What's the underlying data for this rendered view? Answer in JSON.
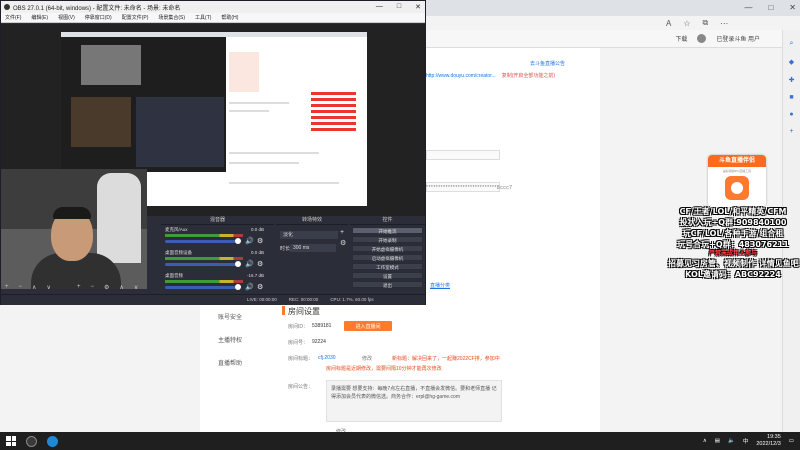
{
  "obs": {
    "title": "OBS 27.0.1 (64-bit, windows) - 配置文件: 未命名 - 场景: 未命名",
    "menu": [
      "文件(F)",
      "编辑(E)",
      "视图(V)",
      "停靠窗口(D)",
      "配置文件(P)",
      "场景集合(S)",
      "工具(T)",
      "帮助(H)"
    ],
    "docks": {
      "mixer_title": "混音器",
      "transitions_title": "转场特效",
      "controls_title": "控件",
      "scenes_title": "场景"
    },
    "mixer": [
      {
        "name": "麦克风/Aux",
        "db": "0.0 dB"
      },
      {
        "name": "桌面音频设备",
        "db": "0.0 dB"
      },
      {
        "name": "桌面音频",
        "db": "-16.7 dB"
      }
    ],
    "transition": {
      "selected": "淡化",
      "duration_label": "时长",
      "duration": "300 ms"
    },
    "controls": [
      "开始推流",
      "开始录制",
      "开始虚拟摄像机",
      "启动虚拟摄像机",
      "工作室模式",
      "设置",
      "退出"
    ],
    "status": {
      "live": "LIVE: 00:00:00",
      "rec": "REC: 00:00:00",
      "cpu": "CPU: 1.7%, 60.00 fps"
    }
  },
  "edge": {
    "download_label": "下载",
    "account_label": "已登录斗鱼 用户"
  },
  "page": {
    "url": "http://www.douyu.com/creator...",
    "url_note": "复制(开启全部功能之前)",
    "top_note": "去斗鱼直播公告",
    "stream_key_mask": "*****************************8ccc7",
    "nav": [
      "账号安全",
      "主播特权",
      "直播帮助"
    ],
    "room_section_title": "房间设置",
    "room_id_label": "房间ID：",
    "room_id": "5389181",
    "room_id_btn": "进入直播间",
    "room_number_label": "房间号：",
    "room_number": "92224",
    "room_title_label": "房间标题：",
    "room_title_link": "cfj.2030",
    "room_title_edit": "修改",
    "room_title_red": "新标题：解决回来了，一起赚2022CF排，参加中",
    "room_title_red2": "房间标题是近期修改，需要间隔10分钟才能再次修改",
    "notice_label": "房间公告：",
    "notice_text": "录播需要 想要支持：每晚7点左右直播，不直播会发微信。要和老师直播 记得添加会员代表的微信选。商务合作：erpl@hg-game.com",
    "link": "直播分类",
    "sub_label": "修改"
  },
  "overlay": {
    "card_title": "斗鱼直播伴侣",
    "card_sub": "是好用的PC直播工具",
    "lines": [
      "CF/王者/LOL/和平精英/CFM",
      "投状入玩+Q群:909840100",
      "玩CF/LOL/各种手游/组合租",
      "玩号合玩+Q群：483076211",
      "严禁未成年人参与",
      "招募见习房管、视频制作 详情见鱼吧",
      "KOL邀请码：ABC92224"
    ]
  },
  "taskbar": {
    "time": "19:35",
    "date": "2022/12/3",
    "lang": "中"
  }
}
